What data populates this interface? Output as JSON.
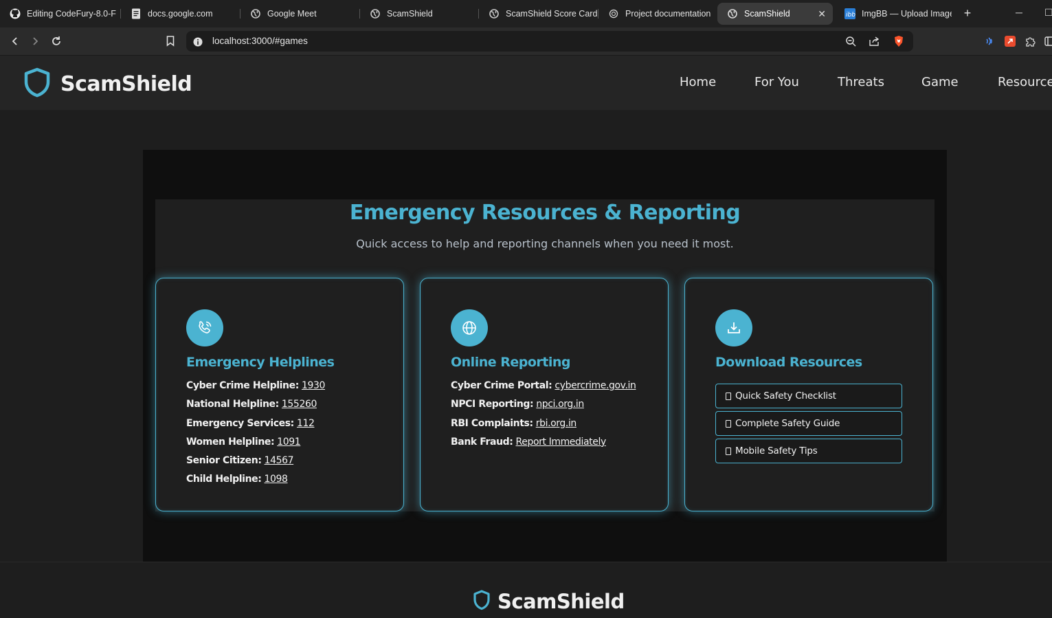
{
  "browser": {
    "tabs": [
      {
        "label": "Editing CodeFury-8.0-F",
        "icon": "github-icon"
      },
      {
        "label": "docs.google.com",
        "icon": "docs-icon"
      },
      {
        "label": "Google Meet",
        "icon": "globe-icon"
      },
      {
        "label": "ScamShield",
        "icon": "globe-icon"
      },
      {
        "label": "ScamShield Score Card",
        "icon": "globe-icon"
      },
      {
        "label": "Project documentation",
        "icon": "chatgpt-icon"
      },
      {
        "label": "ScamShield",
        "icon": "globe-icon",
        "active": true
      },
      {
        "label": "ImgBB — Upload Image",
        "icon": "imgbb-icon"
      }
    ],
    "new_tab": "+",
    "url": "localhost:3000/#games"
  },
  "site": {
    "brand": "ScamShield",
    "nav": [
      "Home",
      "For You",
      "Threats",
      "Game",
      "Resources"
    ]
  },
  "main": {
    "title": "Emergency Resources & Reporting",
    "subtitle": "Quick access to help and reporting channels when you need it most.",
    "cards": [
      {
        "icon": "phone-icon",
        "title": "Emergency Helplines",
        "items": [
          {
            "label": "Cyber Crime Helpline:",
            "value": "1930"
          },
          {
            "label": "National Helpline:",
            "value": "155260"
          },
          {
            "label": "Emergency Services:",
            "value": "112"
          },
          {
            "label": "Women Helpline:",
            "value": "1091"
          },
          {
            "label": "Senior Citizen:",
            "value": "14567"
          },
          {
            "label": "Child Helpline:",
            "value": "1098"
          }
        ]
      },
      {
        "icon": "globe-icon",
        "title": "Online Reporting",
        "items": [
          {
            "label": "Cyber Crime Portal:",
            "value": "cybercrime.gov.in"
          },
          {
            "label": "NPCI Reporting:",
            "value": "npci.org.in"
          },
          {
            "label": "RBI Complaints:",
            "value": "rbi.org.in"
          },
          {
            "label": "Bank Fraud:",
            "value": "Report Immediately"
          }
        ]
      },
      {
        "icon": "download-icon",
        "title": "Download Resources",
        "buttons": [
          "Quick Safety Checklist",
          "Complete Safety Guide",
          "Mobile Safety Tips"
        ]
      }
    ]
  },
  "footer": {
    "brand": "ScamShield"
  },
  "colors": {
    "accent": "#4bb3d1",
    "background": "#1e1e1e",
    "header": "#252525"
  }
}
